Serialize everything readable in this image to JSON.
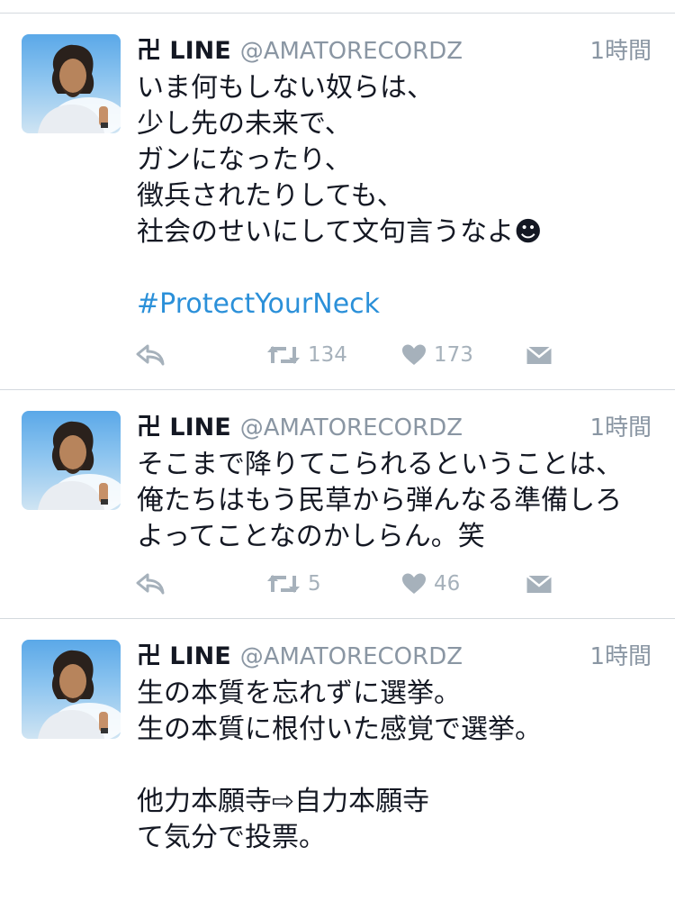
{
  "tweets": [
    {
      "name": "卍 LINE",
      "handle": "@AMATORECORDZ",
      "time": "1時間",
      "lines": [
        "いま何もしない奴らは、",
        "少し先の未来で、",
        "ガンになったり、",
        "徴兵されたりしても、",
        "社会のせいにして文句言うなよ☻",
        "",
        "#ProtectYourNeck"
      ],
      "retweets": "134",
      "likes": "173"
    },
    {
      "name": "卍 LINE",
      "handle": "@AMATORECORDZ",
      "time": "1時間",
      "lines": [
        "そこまで降りてこられるということは、",
        "俺たちはもう民草から弾んなる準備しろ",
        "よってことなのかしらん。笑"
      ],
      "retweets": "5",
      "likes": "46"
    },
    {
      "name": "卍 LINE",
      "handle": "@AMATORECORDZ",
      "time": "1時間",
      "lines": [
        "生の本質を忘れずに選挙。",
        "生の本質に根付いた感覚で選挙。",
        "",
        "他力本願寺⇨自力本願寺",
        "て気分で投票。"
      ]
    }
  ],
  "colors": {
    "link": "#2b90d9",
    "meta": "#8a96a3",
    "action": "#a6b1bb",
    "text": "#141823",
    "divider": "#d4d9de"
  },
  "icons": {
    "reply": "reply-icon",
    "retweet": "retweet-icon",
    "like": "heart-icon",
    "dm": "envelope-icon"
  }
}
